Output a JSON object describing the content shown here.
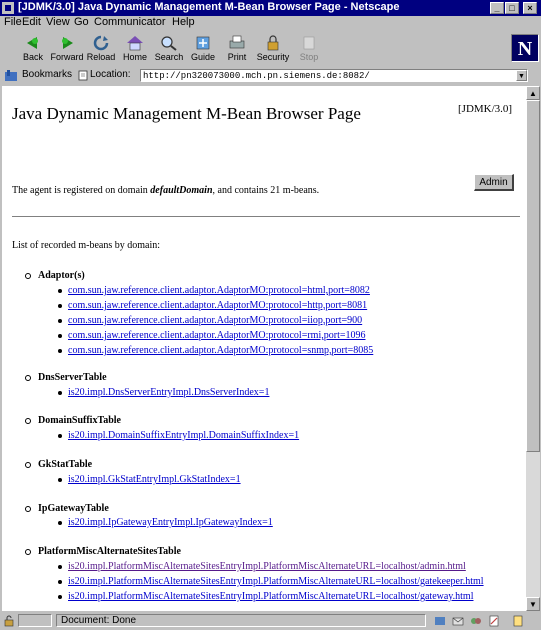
{
  "window": {
    "title": "[JDMK/3.0] Java Dynamic Management M-Bean Browser Page - Netscape"
  },
  "menu": [
    "File",
    "Edit",
    "View",
    "Go",
    "Communicator",
    "Help"
  ],
  "toolbar": [
    "Back",
    "Forward",
    "Reload",
    "Home",
    "Search",
    "Guide",
    "Print",
    "Security",
    "Stop"
  ],
  "location": {
    "bookmarks_label": "Bookmarks",
    "label": "Location:",
    "url": "http://pn320073000.mch.pn.siemens.de:8082/"
  },
  "page": {
    "heading": "Java Dynamic Management M-Bean Browser Page",
    "version": "[JDMK/3.0]",
    "agent_text_prefix": "The agent is registered on domain ",
    "domain": "defaultDomain",
    "agent_text_suffix": ", and contains 21 m-beans.",
    "admin_button": "Admin",
    "list_heading": "List of recorded m-beans by domain:"
  },
  "groups": [
    {
      "name": "Adaptor(s)",
      "items": [
        "com.sun.jaw.reference.client.adaptor.AdaptorMO:protocol=html,port=8082",
        "com.sun.jaw.reference.client.adaptor.AdaptorMO:protocol=http,port=8081",
        "com.sun.jaw.reference.client.adaptor.AdaptorMO:protocol=iiop,port=900",
        "com.sun.jaw.reference.client.adaptor.AdaptorMO:protocol=rmi,port=1096",
        "com.sun.jaw.reference.client.adaptor.AdaptorMO:protocol=snmp,port=8085"
      ]
    },
    {
      "name": "DnsServerTable",
      "items": [
        "is20.impl.DnsServerEntryImpl.DnsServerIndex=1"
      ]
    },
    {
      "name": "DomainSuffixTable",
      "items": [
        "is20.impl.DomainSuffixEntryImpl.DomainSuffixIndex=1"
      ]
    },
    {
      "name": "GkStatTable",
      "items": [
        "is20.impl.GkStatEntryImpl.GkStatIndex=1"
      ]
    },
    {
      "name": "IpGatewayTable",
      "items": [
        "is20.impl.IpGatewayEntryImpl.IpGatewayIndex=1"
      ]
    },
    {
      "name": "PlatformMiscAlternateSitesTable",
      "items": [
        "is20.impl.PlatformMiscAlternateSitesEntryImpl.PlatformMiscAlternateURL=localhost/admin.html",
        "is20.impl.PlatformMiscAlternateSitesEntryImpl.PlatformMiscAlternateURL=localhost/gatekeeper.html",
        "is20.impl.PlatformMiscAlternateSitesEntryImpl.PlatformMiscAlternateURL=localhost/gateway.html"
      ]
    }
  ],
  "status": {
    "text": "Document: Done"
  },
  "colors": {
    "titlebar": "#000080",
    "link": "#0000cc",
    "visited_link": "#551a8b",
    "chrome": "#c0c0c0"
  }
}
